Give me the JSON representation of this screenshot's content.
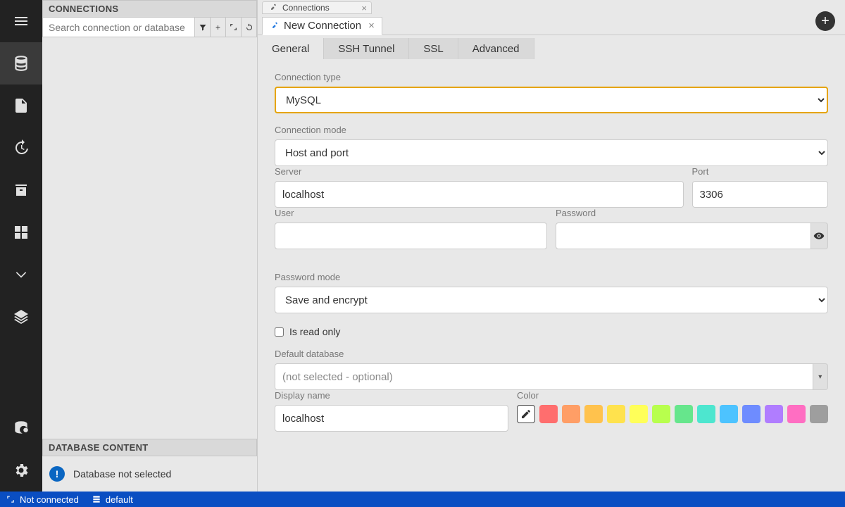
{
  "rail": {
    "items": [
      "menu",
      "database",
      "file",
      "history",
      "archive",
      "plugin",
      "arrow",
      "layers",
      "observe",
      "settings"
    ]
  },
  "left": {
    "connections_header": "CONNECTIONS",
    "search_placeholder": "Search connection or database",
    "db_content_header": "DATABASE CONTENT",
    "db_not_selected": "Database not selected"
  },
  "tabs": {
    "top": "Connections",
    "sub": "New Connection"
  },
  "form_tabs": [
    "General",
    "SSH Tunnel",
    "SSL",
    "Advanced"
  ],
  "form": {
    "connection_type_label": "Connection type",
    "connection_type_value": "MySQL",
    "connection_mode_label": "Connection mode",
    "connection_mode_value": "Host and port",
    "server_label": "Server",
    "server_value": "localhost",
    "port_label": "Port",
    "port_value": "3306",
    "user_label": "User",
    "user_value": "",
    "password_label": "Password",
    "password_value": "",
    "password_mode_label": "Password mode",
    "password_mode_value": "Save and encrypt",
    "readonly_label": "Is read only",
    "default_db_label": "Default database",
    "default_db_placeholder": "(not selected - optional)",
    "display_name_label": "Display name",
    "display_name_value": "localhost",
    "color_label": "Color"
  },
  "colors": [
    "#ff6e6e",
    "#ff9e66",
    "#ffc24d",
    "#ffe24d",
    "#ffff59",
    "#b8ff4d",
    "#66e68c",
    "#4de6cf",
    "#4dc3ff",
    "#6e8cff",
    "#b07dff",
    "#ff6ec2",
    "#9e9e9e"
  ],
  "statusbar": {
    "connection": "Not connected",
    "profile": "default"
  }
}
